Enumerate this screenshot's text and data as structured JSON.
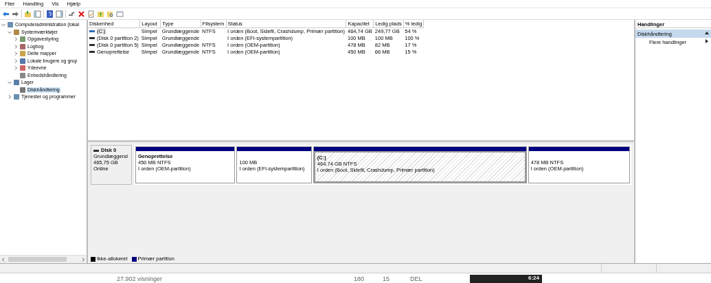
{
  "menu": [
    "Filer",
    "Handling",
    "Vis",
    "Hjælp"
  ],
  "tree": [
    {
      "label": "Computeradministration (lokal",
      "expanded": true,
      "selected": false,
      "children": [
        {
          "label": "Systemværktøjer",
          "expanded": true,
          "selected": false,
          "children": [
            {
              "label": "Opgavestyring",
              "expanded": false,
              "selected": false
            },
            {
              "label": "Logbog",
              "expanded": false,
              "selected": false
            },
            {
              "label": "Delte mapper",
              "expanded": false,
              "selected": false
            },
            {
              "label": "Lokale brugere og grup",
              "expanded": false,
              "selected": false
            },
            {
              "label": "Ydeevne",
              "expanded": false,
              "selected": false
            },
            {
              "label": "Enhedshåndtering",
              "selected": false
            }
          ]
        },
        {
          "label": "Lager",
          "expanded": true,
          "selected": false,
          "children": [
            {
              "label": "Diskhåndtering",
              "selected": true
            }
          ]
        },
        {
          "label": "Tjenester og programmer",
          "expanded": false,
          "selected": false
        }
      ]
    }
  ],
  "table": {
    "columns": [
      "Diskenhed",
      "Layout",
      "Type",
      "Filsystem",
      "Status",
      "Kapacitet",
      "Ledig plads",
      "% ledig"
    ],
    "rows": [
      {
        "selected": true,
        "color": "#2f6fb8",
        "cells": [
          "(C:)",
          "Simpel",
          "Grundlæggende",
          "NTFS",
          "I orden (Boot, Sidefil, Crashdump, Primær partition)",
          "464,74 GB",
          "249,77 GB",
          "54 %"
        ]
      },
      {
        "selected": false,
        "color": "#303030",
        "cells": [
          "(Disk 0 partition 2)",
          "Simpel",
          "Grundlæggende",
          "",
          "I orden (EFI-systempartition)",
          "100 MB",
          "100 MB",
          "100 %"
        ]
      },
      {
        "selected": false,
        "color": "#303030",
        "cells": [
          "(Disk 0 partition 5)",
          "Simpel",
          "Grundlæggende",
          "NTFS",
          "I orden (OEM-partition)",
          "478 MB",
          "82 MB",
          "17 %"
        ]
      },
      {
        "selected": false,
        "color": "#303030",
        "cells": [
          "Genoprettelse",
          "Simpel",
          "Grundlæggende",
          "NTFS",
          "I orden (OEM-partition)",
          "450 MB",
          "66 MB",
          "15 %"
        ]
      }
    ]
  },
  "disk": {
    "name": "Disk 0",
    "lines": [
      "Grundlæggend",
      "465,75 GB",
      "Online"
    ],
    "partitions": [
      {
        "selected": false,
        "title": "Genoprettelse",
        "size": "450 MB NTFS",
        "status": "I orden (OEM-partition)"
      },
      {
        "selected": false,
        "size": "100 MB",
        "status": "I orden (EFI-systempartition)"
      },
      {
        "selected": true,
        "title": "(C:)",
        "size": "464,74 GB NTFS",
        "status": "I orden (Boot, Sidefil, Crashdump, Primær partition)"
      },
      {
        "selected": false,
        "size": "478 MB NTFS",
        "status": "I orden (OEM-partition)"
      }
    ]
  },
  "legend": [
    {
      "label": "Ikke-allokeret",
      "color": "#000000"
    },
    {
      "label": "Primær partition",
      "color": "#000080"
    }
  ],
  "actions": {
    "title": "Handlinger",
    "section": "Diskhåndtering",
    "expanded": true,
    "items": [
      "Flere handlinger"
    ]
  },
  "background": {
    "views": "27.902 visninger",
    "likes": "180",
    "dislikes": "15",
    "share": "DEL",
    "duration": "6:24"
  }
}
